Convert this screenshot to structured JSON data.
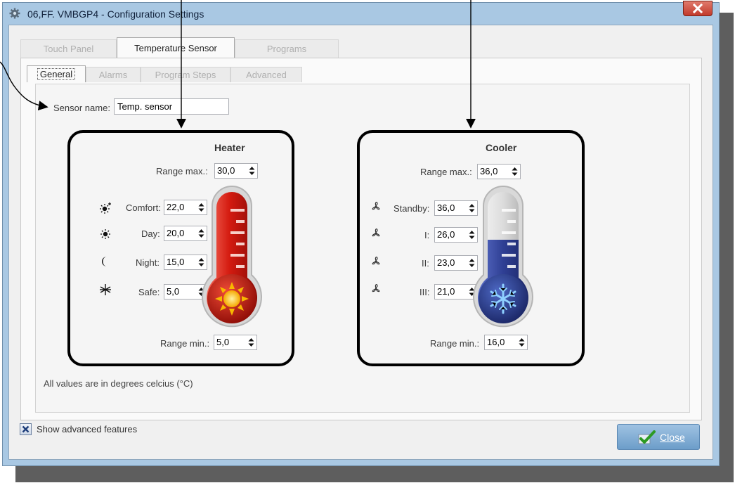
{
  "window": {
    "title": "06,FF. VMBGP4 - Configuration Settings",
    "icon": "gear-icon",
    "close_icon": "close-icon"
  },
  "tabs": [
    {
      "label": "Touch Panel",
      "active": false
    },
    {
      "label": "Temperature Sensor",
      "active": true
    },
    {
      "label": "Programs",
      "active": false
    }
  ],
  "subtabs": [
    {
      "label": "General",
      "active": true
    },
    {
      "label": "Alarms",
      "active": false
    },
    {
      "label": "Program Steps",
      "active": false
    },
    {
      "label": "Advanced",
      "active": false
    }
  ],
  "sensor": {
    "name_label": "Sensor name:",
    "name_value": "Temp. sensor"
  },
  "heater": {
    "title": "Heater",
    "range_max_label": "Range max.:",
    "range_max": "30,0",
    "range_min_label": "Range min.:",
    "range_min": "5,0",
    "rows": [
      {
        "icon": "sun-plus-icon",
        "label": "Comfort:",
        "value": "22,0"
      },
      {
        "icon": "sun-icon",
        "label": "Day:",
        "value": "20,0"
      },
      {
        "icon": "moon-icon",
        "label": "Night:",
        "value": "15,0"
      },
      {
        "icon": "snowflake-icon",
        "label": "Safe:",
        "value": "5,0"
      }
    ],
    "thermometer_icon": "heater-thermometer-icon"
  },
  "cooler": {
    "title": "Cooler",
    "range_max_label": "Range max.:",
    "range_max": "36,0",
    "range_min_label": "Range min.:",
    "range_min": "16,0",
    "rows": [
      {
        "icon": "fan-icon",
        "label": "Standby:",
        "value": "36,0"
      },
      {
        "icon": "fan-icon",
        "label": "I:",
        "value": "26,0"
      },
      {
        "icon": "fan-icon",
        "label": "II:",
        "value": "23,0"
      },
      {
        "icon": "fan-icon",
        "label": "III:",
        "value": "21,0"
      }
    ],
    "thermometer_icon": "cooler-thermometer-icon"
  },
  "footnote": "All values are in degrees celcius (°C)",
  "footer": {
    "checkbox_label": "Show advanced features",
    "checkbox_checked": true,
    "close_label": "Close"
  },
  "colors": {
    "heater_red": "#c8160e",
    "cooler_blue": "#2f3f94",
    "window_frame": "#a9c8e3",
    "close_button": "#6c9dc9"
  }
}
